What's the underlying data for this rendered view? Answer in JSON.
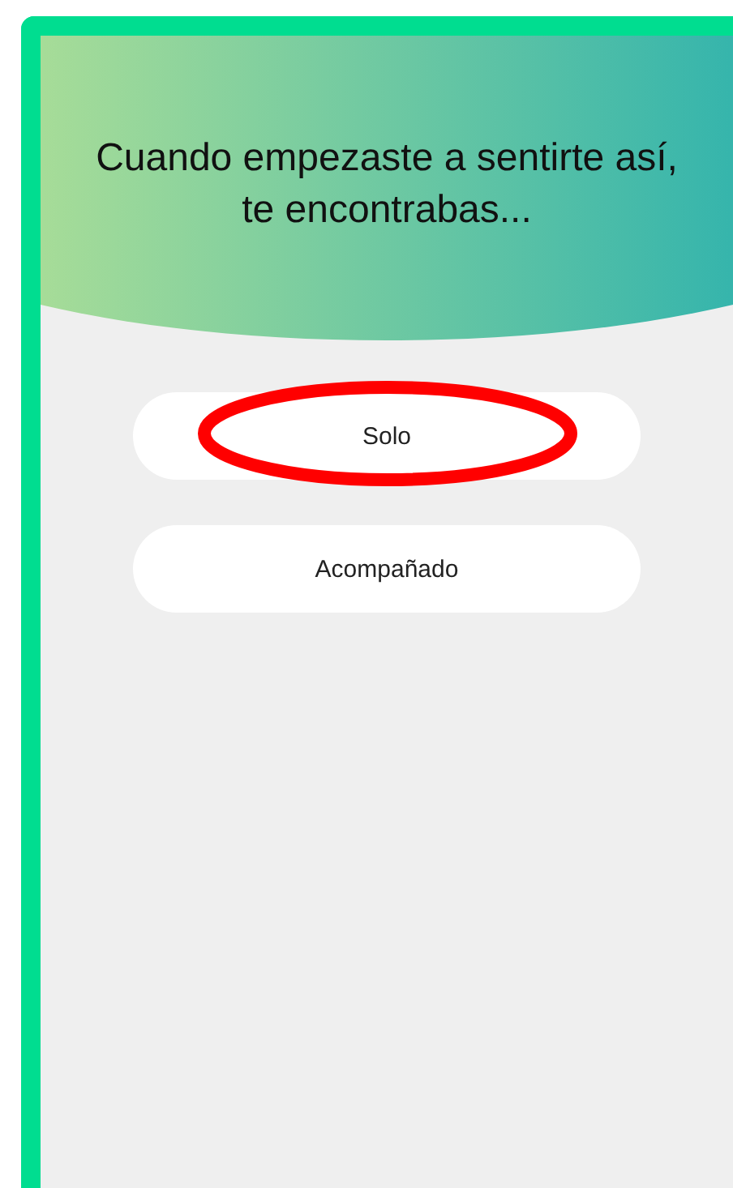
{
  "question": "Cuando empezaste a sentirte así, te encontrabas...",
  "options": [
    {
      "label": "Solo",
      "circled": true
    },
    {
      "label": "Acompañado",
      "circled": false
    }
  ]
}
